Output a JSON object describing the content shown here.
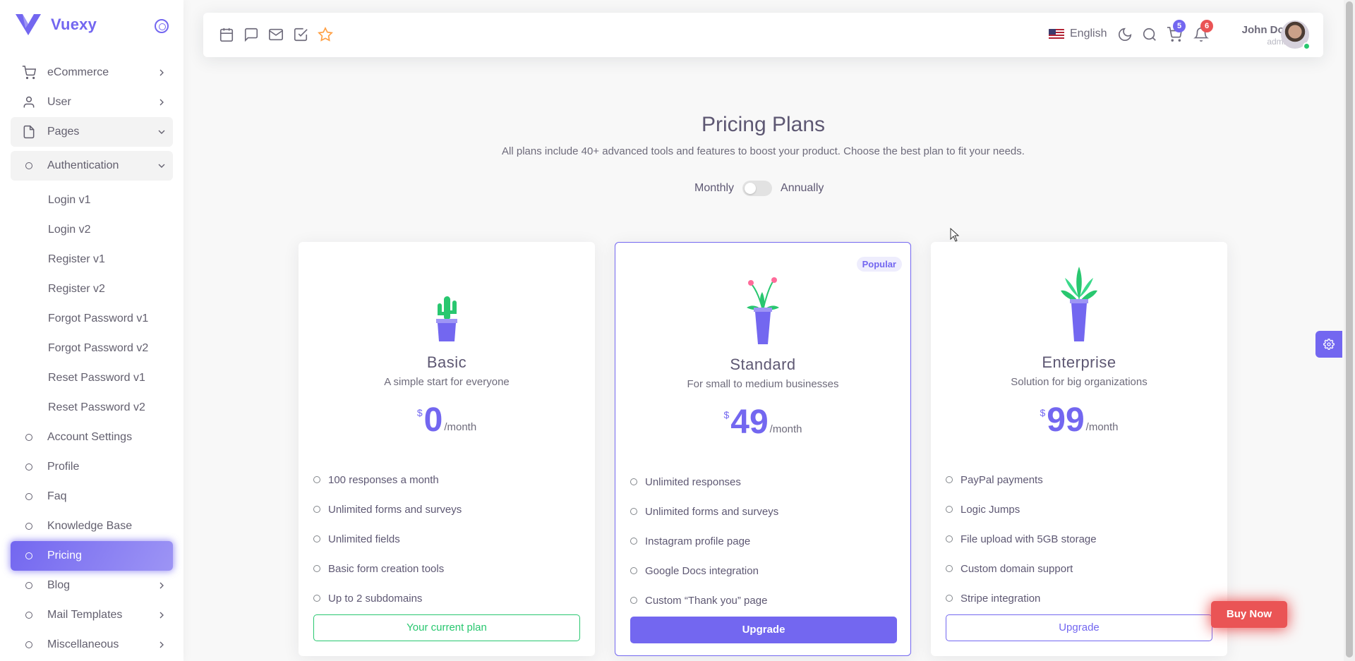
{
  "brand": {
    "name": "Vuexy"
  },
  "sidebar": {
    "items": [
      {
        "label": "eCommerce",
        "icon": "cart-icon"
      },
      {
        "label": "User",
        "icon": "user-icon"
      },
      {
        "label": "Pages",
        "icon": "file-icon"
      },
      {
        "label": "Authentication",
        "icon": "circle-icon"
      },
      {
        "label": "Account Settings",
        "icon": "circle-icon"
      },
      {
        "label": "Profile",
        "icon": "circle-icon"
      },
      {
        "label": "Faq",
        "icon": "circle-icon"
      },
      {
        "label": "Knowledge Base",
        "icon": "circle-icon"
      },
      {
        "label": "Pricing",
        "icon": "circle-icon"
      },
      {
        "label": "Blog",
        "icon": "circle-icon"
      },
      {
        "label": "Mail Templates",
        "icon": "circle-icon"
      },
      {
        "label": "Miscellaneous",
        "icon": "circle-icon"
      }
    ],
    "auth_subitems": [
      "Login v1",
      "Login v2",
      "Register v1",
      "Register v2",
      "Forgot Password v1",
      "Forgot Password v2",
      "Reset Password v1",
      "Reset Password v2"
    ]
  },
  "navbar": {
    "language": "English",
    "cart_count": "5",
    "notification_count": "6",
    "user_name": "John Doe",
    "user_role": "admin"
  },
  "pricing": {
    "title": "Pricing Plans",
    "subtitle": "All plans include 40+ advanced tools and features to boost your product. Choose the best plan to fit your needs.",
    "toggle_monthly": "Monthly",
    "toggle_annually": "Annually",
    "billing_annual_enabled": false,
    "plans": [
      {
        "name": "Basic",
        "description": "A simple start for everyone",
        "currency": "$",
        "price": "0",
        "period": "/month",
        "features": [
          "100 responses a month",
          "Unlimited forms and surveys",
          "Unlimited fields",
          "Basic form creation tools",
          "Up to 2 subdomains"
        ],
        "button": "Your current plan"
      },
      {
        "name": "Standard",
        "badge": "Popular",
        "description": "For small to medium businesses",
        "currency": "$",
        "price": "49",
        "period": "/month",
        "features": [
          "Unlimited responses",
          "Unlimited forms and surveys",
          "Instagram profile page",
          "Google Docs integration",
          "Custom “Thank you” page"
        ],
        "button": "Upgrade"
      },
      {
        "name": "Enterprise",
        "description": "Solution for big organizations",
        "currency": "$",
        "price": "99",
        "period": "/month",
        "features": [
          "PayPal payments",
          "Logic Jumps",
          "File upload with 5GB storage",
          "Custom domain support",
          "Stripe integration"
        ],
        "button": "Upgrade"
      }
    ]
  },
  "buy_now": "Buy Now",
  "colors": {
    "primary": "#7367f0",
    "success": "#28c76f",
    "danger": "#ea5455"
  }
}
